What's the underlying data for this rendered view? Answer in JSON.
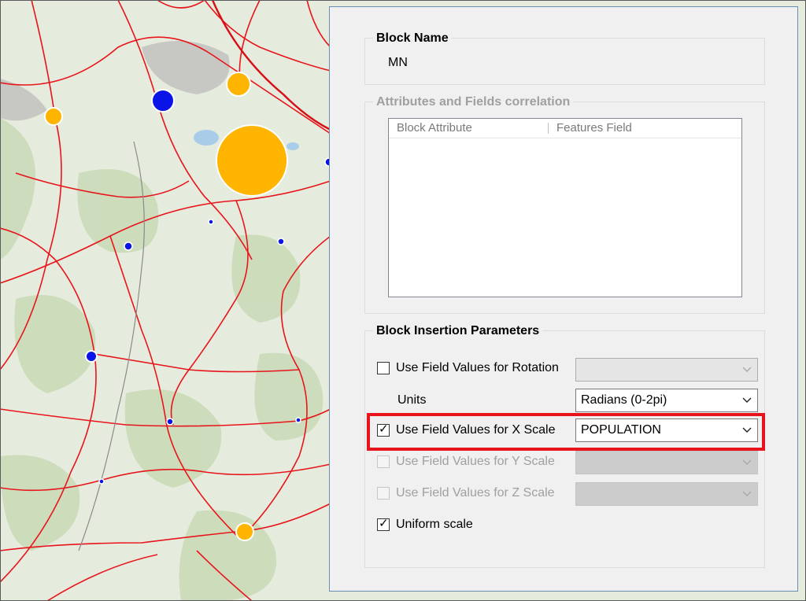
{
  "block_name": {
    "title": "Block Name",
    "value": "MN"
  },
  "attributes": {
    "title": "Attributes and Fields correlation",
    "columns": [
      "Block Attribute",
      "Features Field"
    ]
  },
  "insertion": {
    "title": "Block Insertion Parameters",
    "rotation": {
      "label": "Use Field Values for Rotation",
      "checked": false,
      "value": ""
    },
    "units": {
      "label": "Units",
      "value": "Radians (0-2pi)"
    },
    "x_scale": {
      "label": "Use Field Values for X Scale",
      "checked": true,
      "value": "POPULATION"
    },
    "y_scale": {
      "label": "Use Field Values for Y Scale",
      "checked": false,
      "value": ""
    },
    "z_scale": {
      "label": "Use Field Values for Z Scale",
      "checked": false,
      "value": ""
    },
    "uniform": {
      "label": "Uniform scale",
      "checked": true
    }
  },
  "colors": {
    "road": "#e8141b",
    "large_symbol": "#ffb400",
    "small_symbol": "#0a14e6",
    "highlight": "#e8141b"
  }
}
